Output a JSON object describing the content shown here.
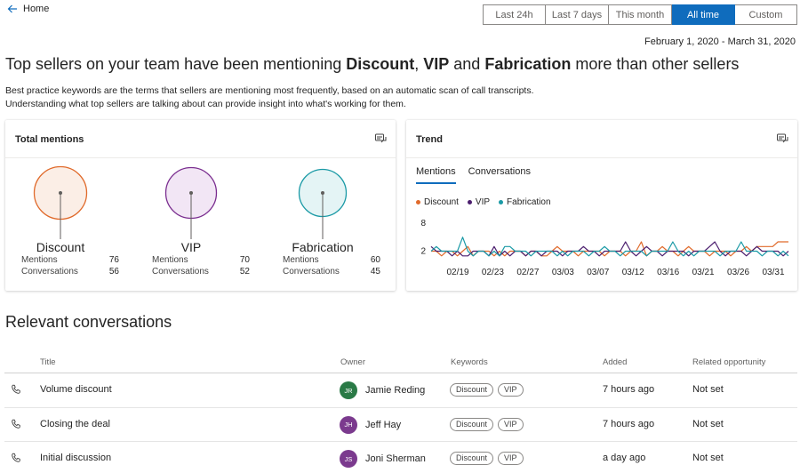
{
  "nav": {
    "home_label": "Home"
  },
  "time_range": {
    "options": [
      "Last 24h",
      "Last 7 days",
      "This month",
      "All time",
      "Custom"
    ],
    "selected": "All time"
  },
  "date_range": "February 1, 2020 - March 31, 2020",
  "headline": {
    "prefix": "Top sellers on your team have been mentioning ",
    "kw1": "Discount",
    "sep1": ", ",
    "kw2": "VIP",
    "sep2": " and ",
    "kw3": "Fabrication",
    "suffix": " more than other sellers"
  },
  "description": {
    "line1": "Best practice keywords are the terms that sellers are mentioning most frequently, based on an automatic scan of call transcripts.",
    "line2": "Understanding what top sellers are talking about can provide insight into what's working for them."
  },
  "total_mentions": {
    "title": "Total mentions",
    "mentions_label": "Mentions",
    "conversations_label": "Conversations",
    "keywords": [
      {
        "name": "Discount",
        "mentions": "76",
        "conversations": "56",
        "color": "#e06a2b",
        "fill": "#fbeee6"
      },
      {
        "name": "VIP",
        "mentions": "70",
        "conversations": "52",
        "color": "#7a2d8f",
        "fill": "#f2e6f5"
      },
      {
        "name": "Fabrication",
        "mentions": "60",
        "conversations": "45",
        "color": "#1b9aa6",
        "fill": "#e4f4f5"
      }
    ]
  },
  "trend": {
    "title": "Trend",
    "tabs": [
      "Mentions",
      "Conversations"
    ],
    "active_tab": "Mentions"
  },
  "chart_data": {
    "type": "line",
    "title": "",
    "xlabel": "",
    "ylabel": "",
    "y_ticks": [
      "8",
      "2"
    ],
    "x_ticks": [
      "02/19",
      "02/23",
      "02/27",
      "03/03",
      "03/07",
      "03/12",
      "03/16",
      "03/21",
      "03/26",
      "03/31"
    ],
    "x_start": "02/14",
    "ylim": [
      0,
      8
    ],
    "series": [
      {
        "name": "Discount",
        "color": "#e06a2b",
        "values": [
          2,
          2,
          1,
          2,
          2,
          1,
          2,
          3,
          1,
          2,
          2,
          2,
          1,
          2,
          1,
          2,
          2,
          2,
          1,
          2,
          2,
          1,
          1,
          2,
          3,
          2,
          2,
          2,
          1,
          2,
          2,
          2,
          2,
          1,
          2,
          2,
          2,
          1,
          2,
          2,
          4,
          1,
          2,
          2,
          3,
          2,
          2,
          1,
          2,
          3,
          2,
          2,
          2,
          1,
          2,
          2,
          2,
          1,
          2,
          2,
          3,
          2,
          3,
          3,
          3,
          3,
          4,
          4,
          4
        ]
      },
      {
        "name": "VIP",
        "color": "#4b1e6e",
        "values": [
          3,
          2,
          2,
          2,
          1,
          2,
          1,
          1,
          2,
          2,
          2,
          1,
          3,
          1,
          2,
          1,
          2,
          2,
          1,
          2,
          2,
          1,
          2,
          2,
          2,
          1,
          2,
          2,
          2,
          3,
          2,
          2,
          1,
          2,
          2,
          2,
          2,
          4,
          2,
          1,
          2,
          3,
          2,
          2,
          1,
          2,
          2,
          2,
          2,
          1,
          2,
          2,
          2,
          3,
          4,
          2,
          1,
          2,
          2,
          2,
          1,
          2,
          3,
          2,
          2,
          2,
          2,
          1,
          2
        ]
      },
      {
        "name": "Fabrication",
        "color": "#1b9aa6",
        "values": [
          2,
          3,
          2,
          2,
          2,
          2,
          5,
          2,
          1,
          2,
          2,
          1,
          2,
          1,
          3,
          3,
          2,
          2,
          2,
          1,
          2,
          2,
          2,
          2,
          1,
          2,
          1,
          2,
          2,
          2,
          1,
          2,
          2,
          3,
          2,
          2,
          1,
          2,
          2,
          2,
          2,
          1,
          2,
          2,
          2,
          2,
          4,
          2,
          1,
          2,
          1,
          2,
          2,
          2,
          2,
          1,
          2,
          2,
          2,
          4,
          2,
          2,
          2,
          1,
          2,
          2,
          1,
          2,
          1
        ]
      }
    ]
  },
  "conversations": {
    "title": "Relevant conversations",
    "columns": {
      "title": "Title",
      "owner": "Owner",
      "keywords": "Keywords",
      "added": "Added",
      "opportunity": "Related opportunity"
    },
    "rows": [
      {
        "title": "Volume discount",
        "initials": "JR",
        "owner": "Jamie Reding",
        "avatar_color": "#2a7a46",
        "keywords": [
          "Discount",
          "VIP"
        ],
        "added": "7 hours ago",
        "opportunity": "Not set"
      },
      {
        "title": "Closing the deal",
        "initials": "JH",
        "owner": "Jeff Hay",
        "avatar_color": "#7b3a8e",
        "keywords": [
          "Discount",
          "VIP"
        ],
        "added": "7 hours ago",
        "opportunity": "Not set"
      },
      {
        "title": "Initial discussion",
        "initials": "JS",
        "owner": "Joni Sherman",
        "avatar_color": "#7b3a8e",
        "keywords": [
          "Discount",
          "VIP"
        ],
        "added": "a day ago",
        "opportunity": "Not set"
      }
    ]
  }
}
